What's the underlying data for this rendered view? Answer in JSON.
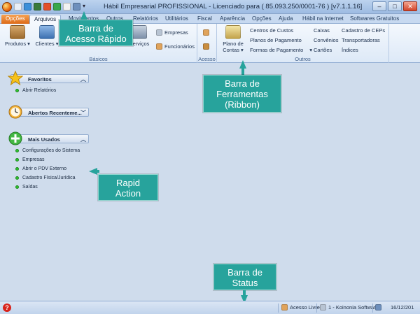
{
  "window": {
    "title": "Hábil Empresarial PROFISSIONAL - Licenciado para  ( 85.093.250/0001-76 ) [v7.1.1.16]"
  },
  "tabs": [
    "Opções",
    "Arquivos",
    "Movimentos",
    "Outros",
    "Relatórios",
    "Utilitários",
    "Fiscal",
    "Aparência",
    "Opções",
    "Ajuda",
    "Hábil na Internet",
    "Softwares Gratuitos"
  ],
  "ribbon": {
    "basicos": {
      "label": "Básicos",
      "produtos": "Produtos",
      "clientes": "Clientes",
      "servicos": "Serviços",
      "empresas": "Empresas",
      "funcionarios": "Funcionários"
    },
    "acesso": {
      "label": "Acesso"
    },
    "outros": {
      "label": "Outros",
      "plano_de_contas_1": "Plano de",
      "plano_de_contas_2": "Contas",
      "centros_de_custos": "Centros de Custos",
      "planos_de_pagamento": "Planos de Pagamento",
      "formas_de_pagamento": "Formas de Pagamento",
      "caixas": "Caixas",
      "convenios": "Convênios",
      "cartoes": "Cartões",
      "cadastro_de_ceps": "Cadastro de CEPs",
      "transportadoras": "Transportadoras",
      "indices": "Índices"
    }
  },
  "panel": {
    "favoritos": {
      "title": "Favoritos",
      "items": [
        "Abrir Relatórios"
      ]
    },
    "abertos": {
      "title": "Abertos Recenteme..."
    },
    "mais_usados": {
      "title": "Mais Usados",
      "items": [
        "Configurações do Sistema",
        "Empresas",
        "Abrir o PDV Externo",
        "Cadastro Física/Jurídica",
        "Saídas"
      ]
    }
  },
  "callouts": {
    "acesso_rapido_1": "Barra de",
    "acesso_rapido_2": "Acesso Rápido",
    "ribbon_1": "Barra de",
    "ribbon_2": "Ferramentas",
    "ribbon_3": "(Ribbon)",
    "rapid_1": "Rapid",
    "rapid_2": "Action",
    "status_1": "Barra de",
    "status_2": "Status"
  },
  "statusbar": {
    "acesso": "Acesso Livre",
    "empresa": "1 - Koinonia Software",
    "data": "16/12/201"
  },
  "colors": {
    "callout": "#27a39c",
    "accent_orange": "#dc6a17",
    "ribbon_bg": "#dde9f7"
  }
}
